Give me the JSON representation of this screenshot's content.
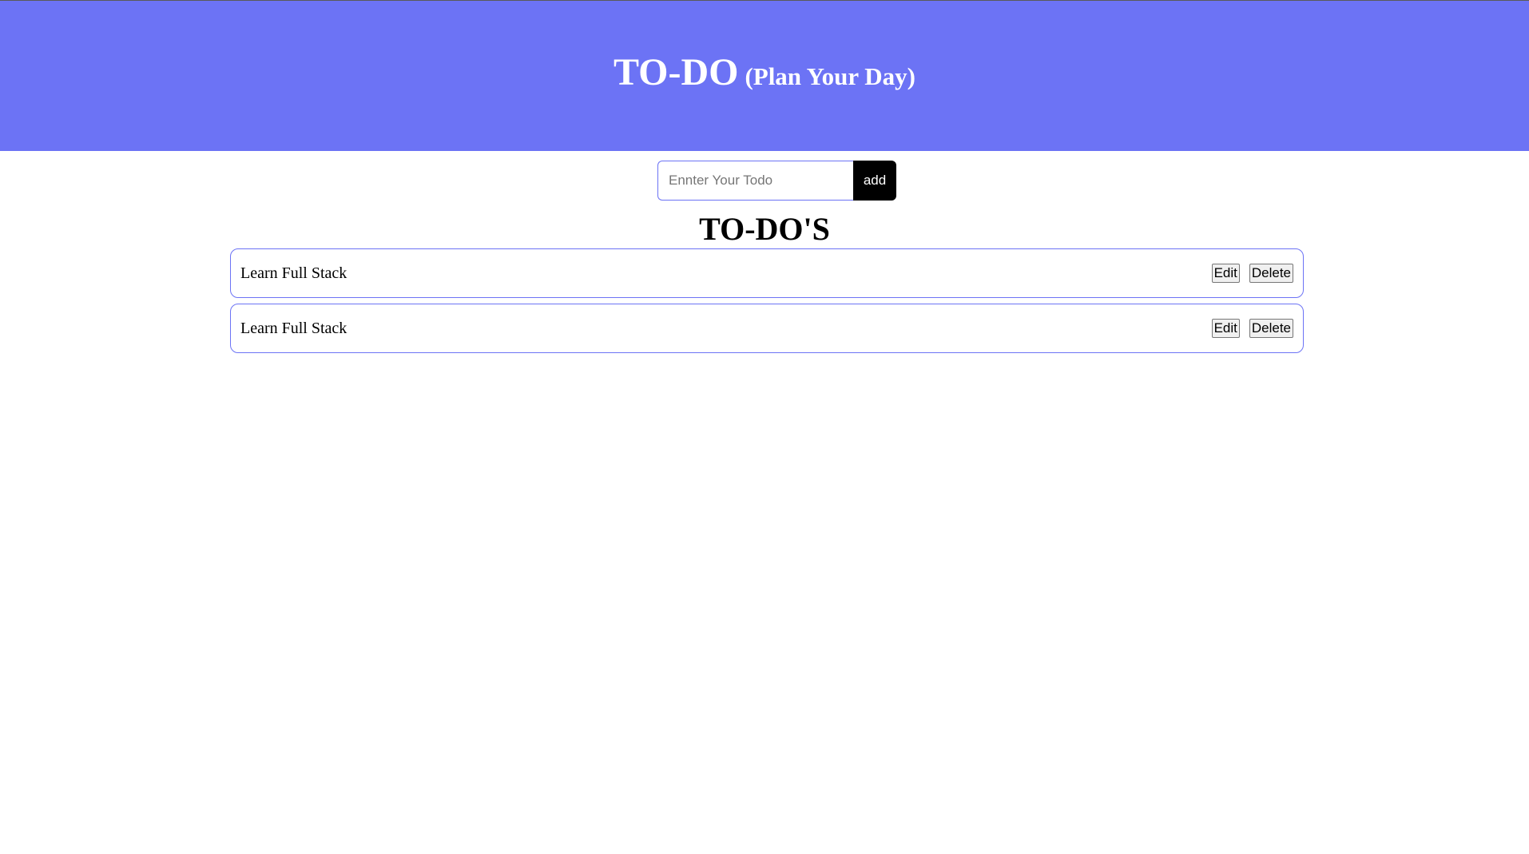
{
  "header": {
    "title": "TO-DO",
    "subtitle": "(Plan Your Day)"
  },
  "form": {
    "input_placeholder": "Ennter Your Todo",
    "input_value": "",
    "add_label": "add"
  },
  "list": {
    "heading": "TO-DO'S",
    "items": [
      {
        "text": "Learn Full Stack",
        "edit_label": "Edit",
        "delete_label": "Delete"
      },
      {
        "text": "Learn Full Stack",
        "edit_label": "Edit",
        "delete_label": "Delete"
      }
    ]
  },
  "colors": {
    "header_bg": "#6c73f5",
    "accent_border": "#6c73f5",
    "add_button_bg": "#000000"
  }
}
